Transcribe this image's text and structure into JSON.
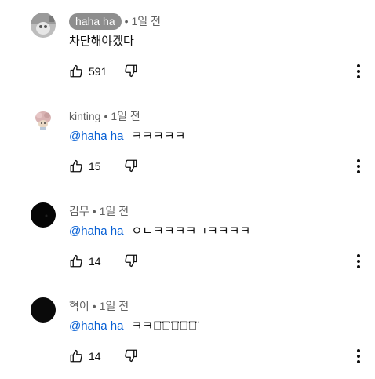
{
  "comments": [
    {
      "author": "haha ha",
      "separator": "•",
      "time": "1일 전",
      "mention": "",
      "text": "차단해야겠다",
      "likes": "591",
      "avatar": "photo-avatar",
      "author_highlighted": true
    },
    {
      "author": "kinting",
      "separator": "•",
      "time": "1일 전",
      "mention": "@haha ha",
      "text": "ㅋㅋㅋㅋㅋ",
      "likes": "15",
      "avatar": "cartoon-avatar",
      "author_highlighted": false
    },
    {
      "author": "김무",
      "separator": "•",
      "time": "1일 전",
      "mention": "@haha ha",
      "text": "ㅇㄴㅋㅋㅋㅋㄱㅋㅋㅋㅋ",
      "likes": "14",
      "avatar": "dark-avatar",
      "author_highlighted": false
    },
    {
      "author": "혁이",
      "separator": "•",
      "time": "1일 전",
      "mention": "@haha ha",
      "text": "ㅋㅋㅊ̈ㅊ̈ㅊ̈ㅊ̈ㅊ̈",
      "likes": "14",
      "avatar": "dark-avatar",
      "author_highlighted": false
    }
  ],
  "icons": {
    "like": "thumbs-up-icon",
    "dislike": "thumbs-down-icon",
    "menu": "more-vertical-icon"
  },
  "colors": {
    "mention": "#065fd4",
    "meta": "#606060",
    "author_chip": "#8e8e8e"
  }
}
